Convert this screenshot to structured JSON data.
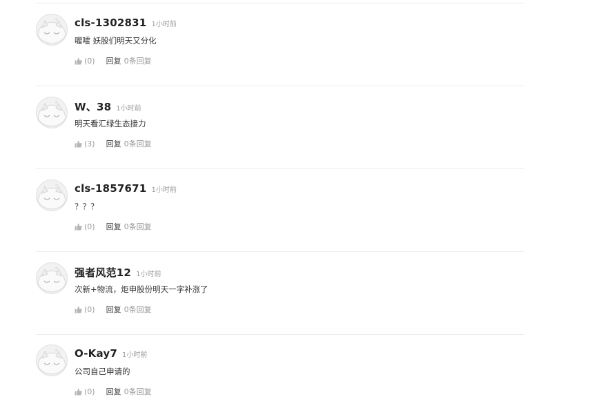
{
  "comments": [
    {
      "username": "cls-1302831",
      "time": "1小时前",
      "content": "喔嚯 妖股们明天又分化",
      "likes": "(0)",
      "reply_label": "回复",
      "reply_count": "0条回复"
    },
    {
      "username": "W、38",
      "time": "1小时前",
      "content": "明天看汇绿生态接力",
      "likes": "(3)",
      "reply_label": "回复",
      "reply_count": "0条回复"
    },
    {
      "username": "cls-1857671",
      "time": "1小时前",
      "content": "？？？",
      "likes": "(0)",
      "reply_label": "回复",
      "reply_count": "0条回复"
    },
    {
      "username": "强者风范12",
      "time": "1小时前",
      "content": "次新+物流，炬申股份明天一字补涨了",
      "likes": "(0)",
      "reply_label": "回复",
      "reply_count": "0条回复"
    },
    {
      "username": "O-Kay7",
      "time": "1小时前",
      "content": "公司自己申请的",
      "likes": "(0)",
      "reply_label": "回复",
      "reply_count": "0条回复"
    }
  ],
  "icons": {
    "avatar": "default-avatar-icon",
    "like": "thumbs-up-icon"
  },
  "colors": {
    "username": "#222222",
    "muted": "#999999",
    "divider": "#ececec"
  }
}
